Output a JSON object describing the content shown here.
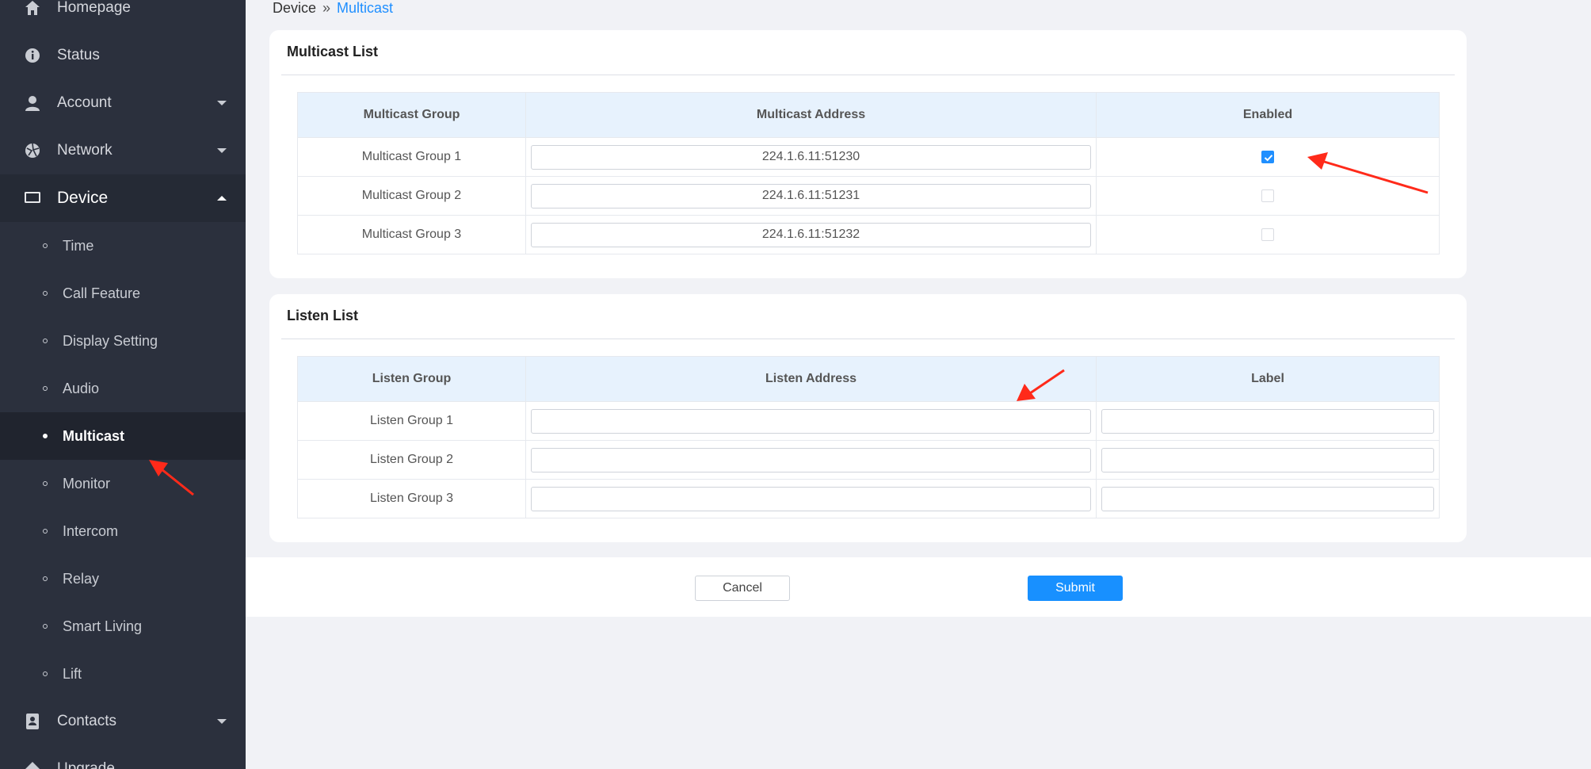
{
  "sidebar": {
    "items": [
      {
        "label": "Homepage",
        "icon": "home-icon"
      },
      {
        "label": "Status",
        "icon": "info-icon"
      },
      {
        "label": "Account",
        "icon": "user-icon"
      },
      {
        "label": "Network",
        "icon": "network-icon"
      },
      {
        "label": "Device",
        "icon": "monitor-icon"
      },
      {
        "label": "Contacts",
        "icon": "contacts-icon"
      },
      {
        "label": "Upgrade",
        "icon": "upgrade-icon"
      }
    ],
    "device_submenu": [
      {
        "label": "Time"
      },
      {
        "label": "Call Feature"
      },
      {
        "label": "Display Setting"
      },
      {
        "label": "Audio"
      },
      {
        "label": "Multicast"
      },
      {
        "label": "Monitor"
      },
      {
        "label": "Intercom"
      },
      {
        "label": "Relay"
      },
      {
        "label": "Smart Living"
      },
      {
        "label": "Lift"
      }
    ],
    "active_submenu": "Multicast"
  },
  "breadcrumb": {
    "root": "Device",
    "separator": "»",
    "current": "Multicast"
  },
  "multicast": {
    "title": "Multicast List",
    "headers": [
      "Multicast Group",
      "Multicast Address",
      "Enabled"
    ],
    "rows": [
      {
        "group": "Multicast Group 1",
        "address": "224.1.6.11:51230",
        "enabled": true
      },
      {
        "group": "Multicast Group 2",
        "address": "224.1.6.11:51231",
        "enabled": false
      },
      {
        "group": "Multicast Group 3",
        "address": "224.1.6.11:51232",
        "enabled": false
      }
    ]
  },
  "listen": {
    "title": "Listen List",
    "headers": [
      "Listen Group",
      "Listen Address",
      "Label"
    ],
    "rows": [
      {
        "group": "Listen Group 1",
        "address": "",
        "label": ""
      },
      {
        "group": "Listen Group 2",
        "address": "",
        "label": ""
      },
      {
        "group": "Listen Group 3",
        "address": "",
        "label": ""
      }
    ]
  },
  "actions": {
    "cancel": "Cancel",
    "submit": "Submit"
  },
  "colors": {
    "accent": "#1890ff",
    "sidebar_bg": "#2b303d",
    "header_bg": "#e7f2fd",
    "annotation": "#ff2a1a"
  }
}
